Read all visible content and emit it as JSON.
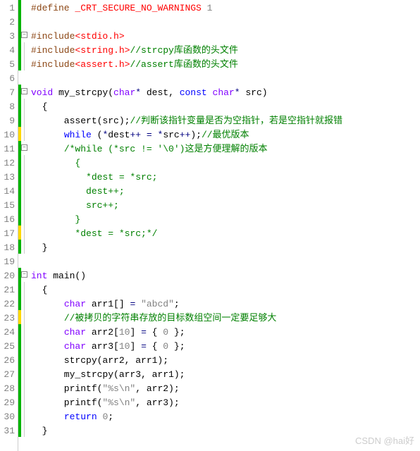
{
  "editor": {
    "lines": [
      {
        "n": 1,
        "bar": "green",
        "fold": "",
        "tokens": [
          [
            "pp",
            "#define"
          ],
          [
            "txt",
            " "
          ],
          [
            "inc",
            "_CRT_SECURE_NO_WARNINGS"
          ],
          [
            "txt",
            " "
          ],
          [
            "str",
            "1"
          ]
        ]
      },
      {
        "n": 2,
        "bar": "green",
        "fold": "",
        "tokens": []
      },
      {
        "n": 3,
        "bar": "green",
        "fold": "minus",
        "tokens": [
          [
            "pp",
            "#include"
          ],
          [
            "inc",
            "<stdio.h>"
          ]
        ]
      },
      {
        "n": 4,
        "bar": "green",
        "fold": "line",
        "tokens": [
          [
            "pp",
            "#include"
          ],
          [
            "inc",
            "<string.h>"
          ],
          [
            "cmt",
            "//strcpy库函数的头文件"
          ]
        ]
      },
      {
        "n": 5,
        "bar": "green",
        "fold": "line",
        "tokens": [
          [
            "pp",
            "#include"
          ],
          [
            "inc",
            "<assert.h>"
          ],
          [
            "cmt",
            "//assert库函数的头文件"
          ]
        ]
      },
      {
        "n": 6,
        "bar": "",
        "fold": "",
        "tokens": []
      },
      {
        "n": 7,
        "bar": "green",
        "fold": "minus",
        "tokens": [
          [
            "type",
            "void"
          ],
          [
            "txt",
            " my_strcpy("
          ],
          [
            "type",
            "char"
          ],
          [
            "op",
            "*"
          ],
          [
            "txt",
            " dest, "
          ],
          [
            "kw",
            "const"
          ],
          [
            "txt",
            " "
          ],
          [
            "type",
            "char"
          ],
          [
            "op",
            "*"
          ],
          [
            "txt",
            " src)"
          ]
        ]
      },
      {
        "n": 8,
        "bar": "green",
        "fold": "line",
        "tokens": [
          [
            "txt",
            "  {"
          ]
        ]
      },
      {
        "n": 9,
        "bar": "green",
        "fold": "line",
        "tokens": [
          [
            "txt",
            "      assert(src);"
          ],
          [
            "cmt",
            "//判断该指针变量是否为空指针，若是空指针就报错"
          ]
        ]
      },
      {
        "n": 10,
        "bar": "yellow",
        "fold": "line",
        "tokens": [
          [
            "txt",
            "      "
          ],
          [
            "kw",
            "while"
          ],
          [
            "txt",
            " ("
          ],
          [
            "op",
            "*"
          ],
          [
            "txt",
            "dest"
          ],
          [
            "op",
            "++"
          ],
          [
            "txt",
            " "
          ],
          [
            "op",
            "="
          ],
          [
            "txt",
            " "
          ],
          [
            "op",
            "*"
          ],
          [
            "txt",
            "src"
          ],
          [
            "op",
            "++"
          ],
          [
            "txt",
            ");"
          ],
          [
            "cmt",
            "//最优版本"
          ]
        ]
      },
      {
        "n": 11,
        "bar": "green",
        "fold": "minus",
        "tokens": [
          [
            "txt",
            "      "
          ],
          [
            "cmt",
            "/*while (*src != '\\0')这是方便理解的版本"
          ]
        ]
      },
      {
        "n": 12,
        "bar": "green",
        "fold": "line",
        "tokens": [
          [
            "cmt",
            "        {"
          ]
        ]
      },
      {
        "n": 13,
        "bar": "green",
        "fold": "line",
        "tokens": [
          [
            "cmt",
            "          *dest = *src;"
          ]
        ]
      },
      {
        "n": 14,
        "bar": "green",
        "fold": "line",
        "tokens": [
          [
            "cmt",
            "          dest++;"
          ]
        ]
      },
      {
        "n": 15,
        "bar": "green",
        "fold": "line",
        "tokens": [
          [
            "cmt",
            "          src++;"
          ]
        ]
      },
      {
        "n": 16,
        "bar": "green",
        "fold": "line",
        "tokens": [
          [
            "cmt",
            "        }"
          ]
        ]
      },
      {
        "n": 17,
        "bar": "yellow",
        "fold": "line",
        "tokens": [
          [
            "cmt",
            "        *dest = *src;*/"
          ]
        ]
      },
      {
        "n": 18,
        "bar": "green",
        "fold": "line",
        "tokens": [
          [
            "txt",
            "  }"
          ]
        ]
      },
      {
        "n": 19,
        "bar": "",
        "fold": "",
        "tokens": []
      },
      {
        "n": 20,
        "bar": "green",
        "fold": "minus",
        "tokens": [
          [
            "type",
            "int"
          ],
          [
            "txt",
            " main()"
          ]
        ]
      },
      {
        "n": 21,
        "bar": "green",
        "fold": "line",
        "tokens": [
          [
            "txt",
            "  {"
          ]
        ]
      },
      {
        "n": 22,
        "bar": "green",
        "fold": "line",
        "tokens": [
          [
            "txt",
            "      "
          ],
          [
            "type",
            "char"
          ],
          [
            "txt",
            " arr1[] "
          ],
          [
            "op",
            "="
          ],
          [
            "txt",
            " "
          ],
          [
            "str",
            "\"abcd\""
          ],
          [
            "txt",
            ";"
          ]
        ]
      },
      {
        "n": 23,
        "bar": "yellow",
        "fold": "line",
        "tokens": [
          [
            "txt",
            "      "
          ],
          [
            "cmt",
            "//被拷贝的字符串存放的目标数组空间一定要足够大"
          ]
        ]
      },
      {
        "n": 24,
        "bar": "green",
        "fold": "line",
        "tokens": [
          [
            "txt",
            "      "
          ],
          [
            "type",
            "char"
          ],
          [
            "txt",
            " arr2["
          ],
          [
            "str",
            "10"
          ],
          [
            "txt",
            "] "
          ],
          [
            "op",
            "="
          ],
          [
            "txt",
            " { "
          ],
          [
            "str",
            "0"
          ],
          [
            "txt",
            " };"
          ]
        ]
      },
      {
        "n": 25,
        "bar": "green",
        "fold": "line",
        "tokens": [
          [
            "txt",
            "      "
          ],
          [
            "type",
            "char"
          ],
          [
            "txt",
            " arr3["
          ],
          [
            "str",
            "10"
          ],
          [
            "txt",
            "] "
          ],
          [
            "op",
            "="
          ],
          [
            "txt",
            " { "
          ],
          [
            "str",
            "0"
          ],
          [
            "txt",
            " };"
          ]
        ]
      },
      {
        "n": 26,
        "bar": "green",
        "fold": "line",
        "tokens": [
          [
            "txt",
            "      strcpy(arr2, arr1);"
          ]
        ]
      },
      {
        "n": 27,
        "bar": "green",
        "fold": "line",
        "tokens": [
          [
            "txt",
            "      my_strcpy(arr3, arr1);"
          ]
        ]
      },
      {
        "n": 28,
        "bar": "green",
        "fold": "line",
        "tokens": [
          [
            "txt",
            "      printf("
          ],
          [
            "str",
            "\"%s\\n\""
          ],
          [
            "txt",
            ", arr2);"
          ]
        ]
      },
      {
        "n": 29,
        "bar": "green",
        "fold": "line",
        "tokens": [
          [
            "txt",
            "      printf("
          ],
          [
            "str",
            "\"%s\\n\""
          ],
          [
            "txt",
            ", arr3);"
          ]
        ]
      },
      {
        "n": 30,
        "bar": "green",
        "fold": "line",
        "tokens": [
          [
            "txt",
            "      "
          ],
          [
            "kw",
            "return"
          ],
          [
            "txt",
            " "
          ],
          [
            "str",
            "0"
          ],
          [
            "txt",
            ";"
          ]
        ]
      },
      {
        "n": 31,
        "bar": "green",
        "fold": "line",
        "tokens": [
          [
            "txt",
            "  }"
          ]
        ]
      }
    ]
  },
  "watermark": "CSDN @hai好"
}
